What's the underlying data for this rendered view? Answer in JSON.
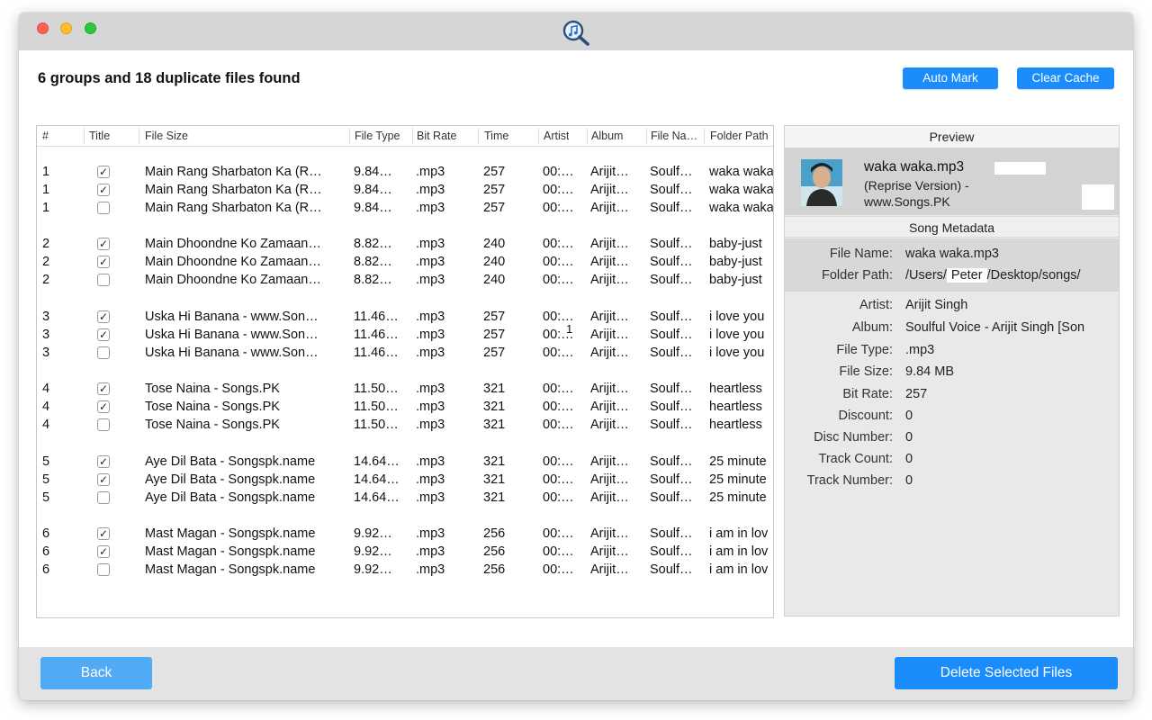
{
  "summary": "6 groups and 18 duplicate files found",
  "toolbar": {
    "auto_mark": "Auto Mark",
    "clear_cache": "Clear Cache"
  },
  "columns": [
    "#",
    "Title",
    "File Size",
    "File Type",
    "Bit Rate",
    "Time",
    "Artist",
    "Album",
    "File Na…",
    "Folder Path"
  ],
  "rows": [
    {
      "group": "1",
      "checked": true,
      "title": "Main Rang Sharbaton Ka (R…",
      "size": "9.84…",
      "type": ".mp3",
      "bitrate": "257",
      "time": "00:…",
      "artist": "Arijit…",
      "album": "Soulf…",
      "folder": "waka waka"
    },
    {
      "group": "1",
      "checked": true,
      "title": "Main Rang Sharbaton Ka (R…",
      "size": "9.84…",
      "type": ".mp3",
      "bitrate": "257",
      "time": "00:…",
      "artist": "Arijit…",
      "album": "Soulf…",
      "folder": "waka waka"
    },
    {
      "group": "1",
      "checked": false,
      "title": "Main Rang Sharbaton Ka (R…",
      "size": "9.84…",
      "type": ".mp3",
      "bitrate": "257",
      "time": "00:…",
      "artist": "Arijit…",
      "album": "Soulf…",
      "folder": "waka waka"
    },
    {
      "group": "2",
      "checked": true,
      "title": "Main Dhoondne Ko Zamaan…",
      "size": "8.82…",
      "type": ".mp3",
      "bitrate": "240",
      "time": "00:…",
      "artist": "Arijit…",
      "album": "Soulf…",
      "folder": "baby-just"
    },
    {
      "group": "2",
      "checked": true,
      "title": "Main Dhoondne Ko Zamaan…",
      "size": "8.82…",
      "type": ".mp3",
      "bitrate": "240",
      "time": "00:…",
      "artist": "Arijit…",
      "album": "Soulf…",
      "folder": "baby-just"
    },
    {
      "group": "2",
      "checked": false,
      "title": "Main Dhoondne Ko Zamaan…",
      "size": "8.82…",
      "type": ".mp3",
      "bitrate": "240",
      "time": "00:…",
      "artist": "Arijit…",
      "album": "Soulf…",
      "folder": "baby-just"
    },
    {
      "group": "3",
      "checked": true,
      "title": "Uska Hi Banana - www.Son…",
      "size": "11.46…",
      "type": ".mp3",
      "bitrate": "257",
      "time": "00:…",
      "artist": "Arijit…",
      "album": "Soulf…",
      "folder": "i love you"
    },
    {
      "group": "3",
      "checked": true,
      "title": "Uska Hi Banana - www.Son…",
      "size": "11.46…",
      "type": ".mp3",
      "bitrate": "257",
      "time": "00:…",
      "artist": "Arijit…",
      "album": "Soulf…",
      "folder": "i love you"
    },
    {
      "group": "3",
      "checked": false,
      "title": "Uska Hi Banana - www.Son…",
      "size": "11.46…",
      "type": ".mp3",
      "bitrate": "257",
      "time": "00:…",
      "artist": "Arijit…",
      "album": "Soulf…",
      "folder": "i love you"
    },
    {
      "group": "4",
      "checked": true,
      "title": "Tose Naina - Songs.PK",
      "size": "11.50…",
      "type": ".mp3",
      "bitrate": "321",
      "time": "00:…",
      "artist": "Arijit…",
      "album": "Soulf…",
      "folder": "heartless"
    },
    {
      "group": "4",
      "checked": true,
      "title": "Tose Naina - Songs.PK",
      "size": "11.50…",
      "type": ".mp3",
      "bitrate": "321",
      "time": "00:…",
      "artist": "Arijit…",
      "album": "Soulf…",
      "folder": "heartless"
    },
    {
      "group": "4",
      "checked": false,
      "title": "Tose Naina - Songs.PK",
      "size": "11.50…",
      "type": ".mp3",
      "bitrate": "321",
      "time": "00:…",
      "artist": "Arijit…",
      "album": "Soulf…",
      "folder": "heartless"
    },
    {
      "group": "5",
      "checked": true,
      "title": "Aye Dil Bata - Songspk.name",
      "size": "14.64…",
      "type": ".mp3",
      "bitrate": "321",
      "time": "00:…",
      "artist": "Arijit…",
      "album": "Soulf…",
      "folder": "25 minute"
    },
    {
      "group": "5",
      "checked": true,
      "title": "Aye Dil Bata - Songspk.name",
      "size": "14.64…",
      "type": ".mp3",
      "bitrate": "321",
      "time": "00:…",
      "artist": "Arijit…",
      "album": "Soulf…",
      "folder": "25 minute"
    },
    {
      "group": "5",
      "checked": false,
      "title": "Aye Dil Bata - Songspk.name",
      "size": "14.64…",
      "type": ".mp3",
      "bitrate": "321",
      "time": "00:…",
      "artist": "Arijit…",
      "album": "Soulf…",
      "folder": "25 minute"
    },
    {
      "group": "6",
      "checked": true,
      "title": "Mast Magan - Songspk.name",
      "size": "9.92…",
      "type": ".mp3",
      "bitrate": "256",
      "time": "00:…",
      "artist": "Arijit…",
      "album": "Soulf…",
      "folder": "i am in lov"
    },
    {
      "group": "6",
      "checked": true,
      "title": "Mast Magan - Songspk.name",
      "size": "9.92…",
      "type": ".mp3",
      "bitrate": "256",
      "time": "00:…",
      "artist": "Arijit…",
      "album": "Soulf…",
      "folder": "i am in lov"
    },
    {
      "group": "6",
      "checked": false,
      "title": "Mast Magan - Songspk.name",
      "size": "9.92…",
      "type": ".mp3",
      "bitrate": "256",
      "time": "00:…",
      "artist": "Arijit…",
      "album": "Soulf…",
      "folder": "i am in lov"
    }
  ],
  "cursor_glyph": "1",
  "preview": {
    "header": "Preview",
    "title": "waka waka.mp3",
    "subtitle_line1": "(Reprise Version) -",
    "subtitle_line2": "www.Songs.PK",
    "metadata_header": "Song Metadata",
    "fields": [
      {
        "label": "File Name:",
        "value": "waka waka.mp3"
      },
      {
        "label": "Folder Path:",
        "value_prefix": "/Users/",
        "value_user": "Peter",
        "value_suffix": "/Desktop/songs/"
      },
      {
        "label": "Artist:",
        "value": "Arijit Singh"
      },
      {
        "label": "Album:",
        "value": "Soulful Voice - Arijit Singh [Son"
      },
      {
        "label": "File Type:",
        "value": ".mp3"
      },
      {
        "label": "File Size:",
        "value": "9.84 MB"
      },
      {
        "label": "Bit Rate:",
        "value": "257"
      },
      {
        "label": "Discount:",
        "value": "0"
      },
      {
        "label": "Disc Number:",
        "value": "0"
      },
      {
        "label": "Track Count:",
        "value": "0"
      },
      {
        "label": "Track Number:",
        "value": "0"
      }
    ]
  },
  "footer": {
    "back": "Back",
    "delete": "Delete Selected Files"
  },
  "colors": {
    "accent": "#1a8cfc",
    "back_button": "#51aaf6",
    "titlebar": "#d6d6d6",
    "footer": "#e3e3e3"
  },
  "icons": {
    "app": "music-search-icon",
    "checkbox_checked": "✓"
  }
}
